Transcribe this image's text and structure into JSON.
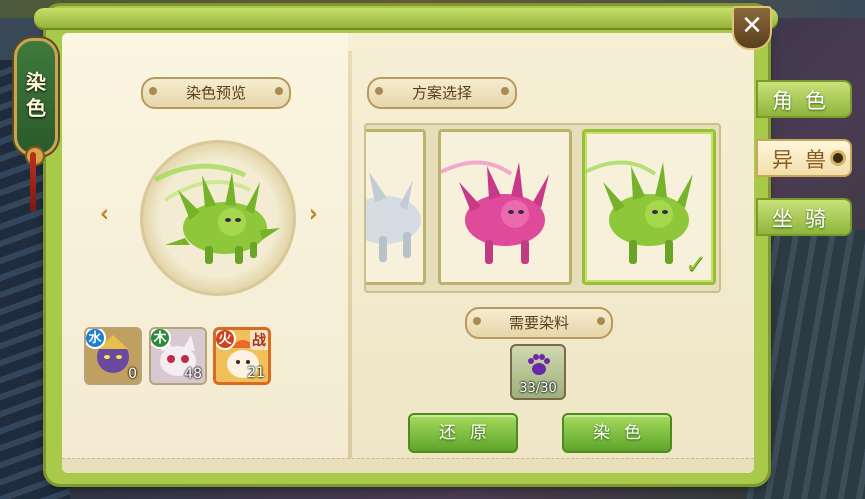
{
  "side_tab": {
    "label_1": "染",
    "label_2": "色"
  },
  "close": {
    "symbol": "✕"
  },
  "right_tabs": [
    {
      "label": "角色",
      "state": "inactive"
    },
    {
      "label": "异兽",
      "state": "active"
    },
    {
      "label": "坐骑",
      "state": "inactive"
    }
  ],
  "preview": {
    "title": "染色预览",
    "prev_arrow": "‹",
    "next_arrow": "›"
  },
  "scheme": {
    "title": "方案选择",
    "check_symbol": "✓"
  },
  "materials": {
    "title": "需要染料",
    "dye_count": "33/30"
  },
  "slots": [
    {
      "element": "水",
      "count": "0",
      "color": "#6a4aa0"
    },
    {
      "element": "木",
      "count": "48",
      "color": "#e8d8e8"
    },
    {
      "element": "火",
      "count": "21",
      "tag": "战",
      "color": "#f2c24a",
      "selected": true
    }
  ],
  "buttons": {
    "restore": "还原",
    "dye": "染色"
  },
  "colors": {
    "green_dye": "#8ec83a",
    "pink_dye": "#e04a9a",
    "white_dye": "#d6dde2"
  }
}
